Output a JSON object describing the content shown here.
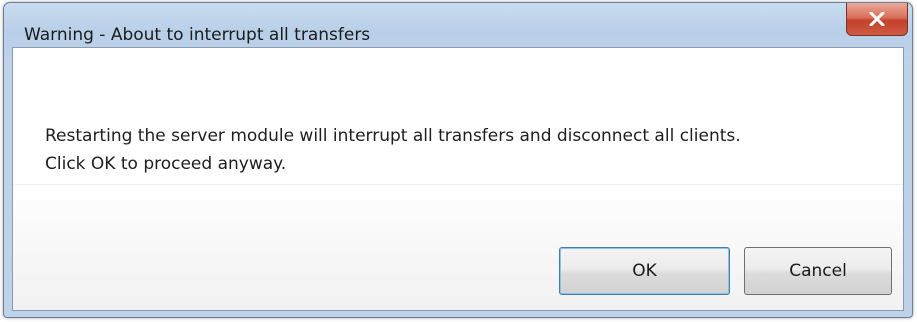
{
  "dialog": {
    "title": "Warning - About to interrupt all transfers",
    "close_icon": "close-icon",
    "message_line1": "Restarting the server module will interrupt all transfers and disconnect all clients.",
    "message_line2": "Click OK to proceed anyway.",
    "ok_label": "OK",
    "cancel_label": "Cancel"
  },
  "colors": {
    "titlebar": "#bed3ea",
    "close_button": "#c4402a",
    "default_button_border": "#3c7fb1"
  }
}
